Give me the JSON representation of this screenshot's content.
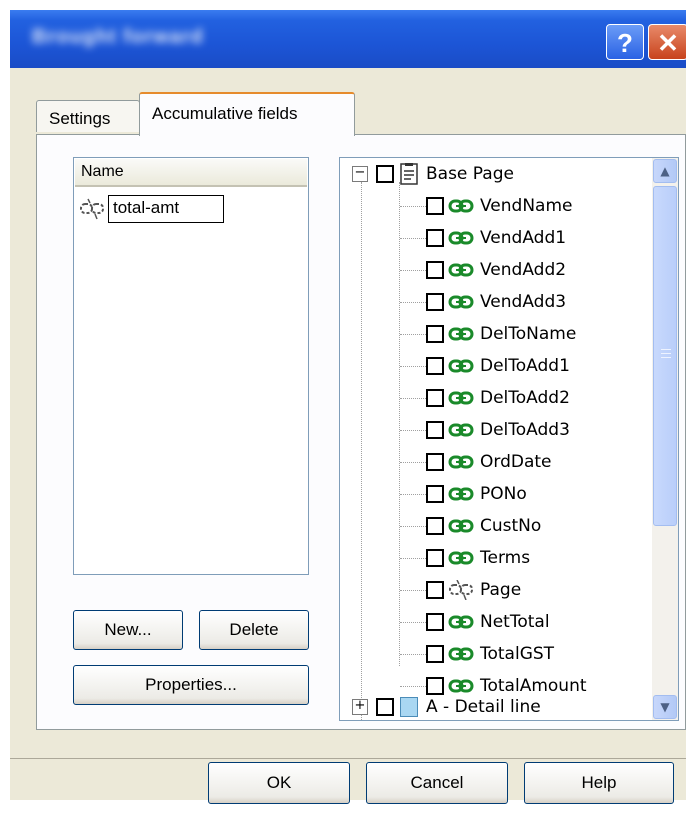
{
  "dialog": {
    "title": "Brought forward",
    "help_glyph": "?",
    "close_glyph": "✕"
  },
  "tabs": [
    {
      "label": "Settings"
    },
    {
      "label": "Accumulative fields"
    }
  ],
  "fields_list": {
    "header": "Name",
    "items": [
      {
        "icon": "link-broken-icon",
        "value": "total-amt"
      }
    ]
  },
  "buttons": {
    "new_label": "New...",
    "delete_label": "Delete",
    "properties_label": "Properties...",
    "ok_label": "OK",
    "cancel_label": "Cancel",
    "help_label": "Help"
  },
  "tree": {
    "root": {
      "expander": "−",
      "label": "Base Page",
      "icon": "page-icon"
    },
    "children": [
      {
        "label": "VendName",
        "icon": "link-icon"
      },
      {
        "label": "VendAdd1",
        "icon": "link-icon"
      },
      {
        "label": "VendAdd2",
        "icon": "link-icon"
      },
      {
        "label": "VendAdd3",
        "icon": "link-icon"
      },
      {
        "label": "DelToName",
        "icon": "link-icon"
      },
      {
        "label": "DelToAdd1",
        "icon": "link-icon"
      },
      {
        "label": "DelToAdd2",
        "icon": "link-icon"
      },
      {
        "label": "DelToAdd3",
        "icon": "link-icon"
      },
      {
        "label": "OrdDate",
        "icon": "link-icon"
      },
      {
        "label": "PONo",
        "icon": "link-icon"
      },
      {
        "label": "CustNo",
        "icon": "link-icon"
      },
      {
        "label": "Terms",
        "icon": "link-icon"
      },
      {
        "label": "Page",
        "icon": "link-broken-icon"
      },
      {
        "label": "NetTotal",
        "icon": "link-icon"
      },
      {
        "label": "TotalGST",
        "icon": "link-icon"
      },
      {
        "label": "TotalAmount",
        "icon": "link-icon"
      }
    ],
    "next": {
      "expander": "+",
      "label": "A - Detail line",
      "icon": "detail-icon"
    }
  },
  "colors": {
    "titlebar": "#1c55d6",
    "link_icon": "#1a8a2a",
    "tab_highlight": "#e68b2c"
  }
}
